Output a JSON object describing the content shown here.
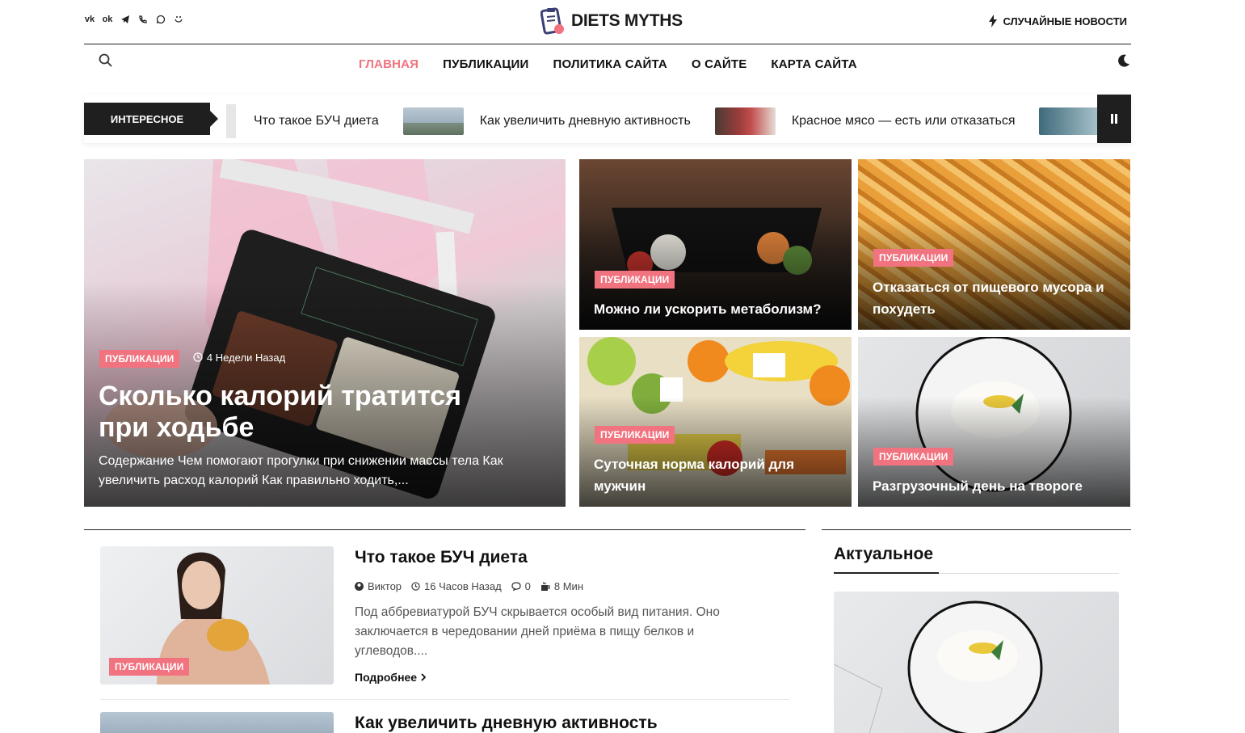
{
  "logo": {
    "text": "DIETS MYTHS"
  },
  "socials": [
    "vk",
    "ok",
    "tg",
    "viber",
    "wa",
    "yt"
  ],
  "header": {
    "random_label": "СЛУЧАЙНЫЕ НОВОСТИ"
  },
  "nav": {
    "items": [
      "ГЛАВНАЯ",
      "ПУБЛИКАЦИИ",
      "ПОЛИТИКА САЙТА",
      "О САЙТЕ",
      "КАРТА САЙТА"
    ],
    "active": 0
  },
  "ticker": {
    "label": "ИНТЕРЕСНОЕ",
    "items": [
      "Что такое БУЧ диета",
      "Как увеличить дневную активность",
      "Красное мясо — есть или отказаться"
    ]
  },
  "hero": {
    "category": "ПУБЛИКАЦИИ",
    "time": "4 Недели Назад",
    "title": "Сколько калорий тратится при ходьбе",
    "excerpt": "Содержание Чем помогают прогулки при снижении массы тела Как увеличить расход калорий Как правильно ходить,..."
  },
  "grid": [
    {
      "category": "ПУБЛИКАЦИИ",
      "title": "Можно ли ускорить метаболизм?"
    },
    {
      "category": "ПУБЛИКАЦИИ",
      "title": "Отказаться от пищевого мусора и похудеть"
    },
    {
      "category": "ПУБЛИКАЦИИ",
      "title": "Суточная норма калорий для мужчин"
    },
    {
      "category": "ПУБЛИКАЦИИ",
      "title": "Разгрузочный день на твороге"
    }
  ],
  "posts": [
    {
      "category": "ПУБЛИКАЦИИ",
      "title": "Что такое БУЧ диета",
      "author": "Виктор",
      "time": "16 Часов Назад",
      "comments": "0",
      "read": "8 Мин",
      "excerpt": "Под аббревиатурой БУЧ скрывается особый вид питания. Оно заключается в чередовании дней приёма в пищу белков и углеводов....",
      "more": "Подробнее"
    },
    {
      "title": "Как увеличить дневную активность"
    }
  ],
  "sidebar": {
    "title": "Актуальное"
  },
  "colors": {
    "accent": "#f0737f",
    "dark": "#1f1f1f"
  }
}
